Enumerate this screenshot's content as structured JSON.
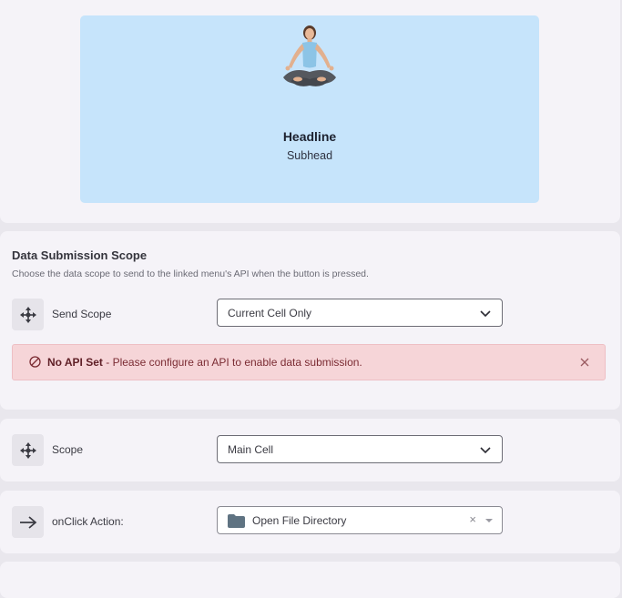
{
  "preview": {
    "headline": "Headline",
    "subhead": "Subhead"
  },
  "data_scope": {
    "title": "Data Submission Scope",
    "description": "Choose the data scope to send to the linked menu's API when the button is pressed.",
    "send_scope_label": "Send Scope",
    "send_scope_value": "Current Cell Only",
    "alert_bold": "No API Set",
    "alert_text": " - Please configure an API to enable data submission."
  },
  "scope": {
    "label": "Scope",
    "value": "Main Cell"
  },
  "onclick": {
    "label": "onClick Action:",
    "value": "Open File Directory",
    "clear": "×"
  },
  "colors": {
    "preview_bg": "#c6e4fb",
    "alert_bg": "#f6d5d8",
    "panel_bg": "#f5f3f8"
  },
  "icons": [
    "move-arrows-icon",
    "warning-circle-icon",
    "close-icon",
    "chevron-down-icon",
    "arrow-right-icon",
    "folder-icon"
  ]
}
